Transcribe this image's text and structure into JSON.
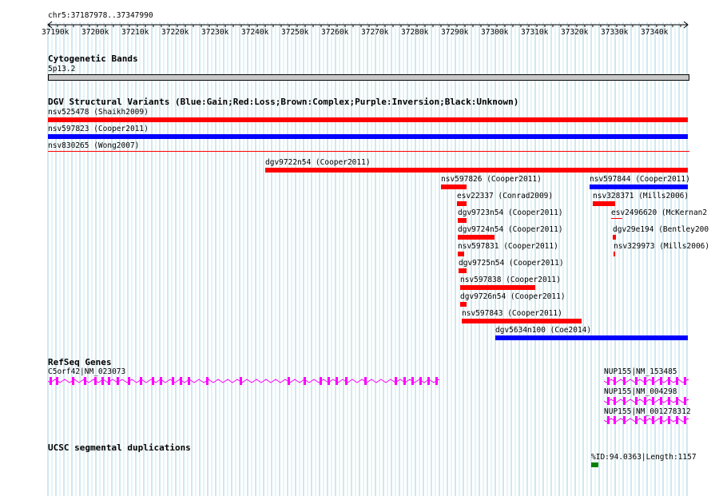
{
  "coords": "chr5:37187978..37347990",
  "ruler": {
    "ticks": [
      "37190k",
      "37200k",
      "37210k",
      "37220k",
      "37230k",
      "37240k",
      "37250k",
      "37260k",
      "37270k",
      "37280k",
      "37290k",
      "37300k",
      "37310k",
      "37320k",
      "37330k",
      "37340k"
    ]
  },
  "tracks": {
    "cyto": {
      "title": "Cytogenetic Bands",
      "band": "5p13.2"
    },
    "dgv": {
      "title": "DGV Structural Variants (Blue:Gain;Red:Loss;Brown:Complex;Purple:Inversion;Black:Unknown)",
      "features": [
        {
          "label": "nsv525478 (Shaikh2009)",
          "color": "#ff0000"
        },
        {
          "label": "nsv597823 (Cooper2011)",
          "color": "#0000ff"
        },
        {
          "label": "nsv830265 (Wong2007)",
          "color": "#ff0000"
        },
        {
          "label": "dgv9722n54 (Cooper2011)",
          "color": "#ff0000"
        },
        {
          "label": "nsv597826 (Cooper2011)",
          "color": "#ff0000"
        },
        {
          "label": "nsv597844 (Cooper2011)",
          "color": "#0000ff"
        },
        {
          "label": "esv22337 (Conrad2009)",
          "color": "#ff0000"
        },
        {
          "label": "nsv328371 (Mills2006)",
          "color": "#ff0000"
        },
        {
          "label": "dgv9723n54 (Cooper2011)",
          "color": "#ff0000"
        },
        {
          "label": "esv2496620 (McKernan2",
          "color": "#ff0000"
        },
        {
          "label": "dgv9724n54 (Cooper2011)",
          "color": "#ff0000"
        },
        {
          "label": "dgv29e194 (Bentley200",
          "color": "#ff0000"
        },
        {
          "label": "nsv597831 (Cooper2011)",
          "color": "#ff0000"
        },
        {
          "label": "nsv329973 (Mills2006)",
          "color": "#ff0000"
        },
        {
          "label": "dgv9725n54 (Cooper2011)",
          "color": "#ff0000"
        },
        {
          "label": "nsv597838 (Cooper2011)",
          "color": "#ff0000"
        },
        {
          "label": "dgv9726n54 (Cooper2011)",
          "color": "#ff0000"
        },
        {
          "label": "nsv597843 (Cooper2011)",
          "color": "#ff0000"
        },
        {
          "label": "dgv5634n100 (Coe2014)",
          "color": "#0000ff"
        }
      ]
    },
    "refseq": {
      "title": "RefSeq Genes",
      "genes": [
        {
          "label": "C5orf42|NM_023073",
          "color": "#ff00ff"
        },
        {
          "label": "NUP155|NM_153485",
          "color": "#ff00ff"
        },
        {
          "label": "NUP155|NM_004298",
          "color": "#ff00ff"
        },
        {
          "label": "NUP155|NM_001278312",
          "color": "#ff00ff"
        }
      ]
    },
    "segdup": {
      "title": "UCSC segmental duplications",
      "features": [
        {
          "label": "%ID:94.0363|Length:1157",
          "color": "#008000"
        }
      ]
    }
  }
}
